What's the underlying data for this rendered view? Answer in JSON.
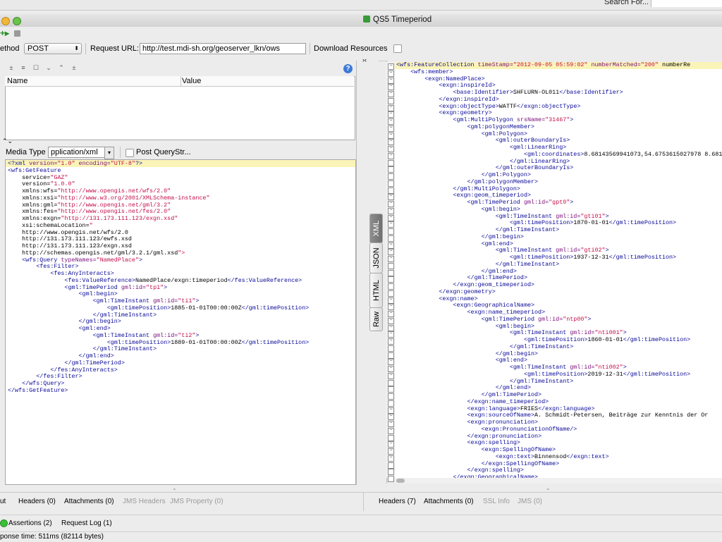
{
  "search": {
    "label": "Search For..."
  },
  "window": {
    "title": "QS5 Timeperiod"
  },
  "toolbar": {
    "method_label": "ethod",
    "method_value": "POST",
    "request_url_label": "Request URL:",
    "request_url_value": "http://test.mdi-sh.org/geoserver_lkn/ows",
    "download_label": "Download Resources"
  },
  "params": {
    "col_name": "Name",
    "col_value": "Value"
  },
  "media": {
    "label": "Media Type",
    "value": "pplication/xml",
    "post_query_label": "Post QueryStr..."
  },
  "side_tabs": [
    "XML",
    "JSON",
    "HTML",
    "Raw"
  ],
  "request_xml": [
    "<?xml version=\"1.0\" encoding=\"UTF-8\"?>",
    "<wfs:GetFeature",
    "    service=\"GAZ\"",
    "    version=\"1.0.0\"",
    "    xmlns:wfs=\"http://www.opengis.net/wfs/2.0\"",
    "    xmlns:xsi=\"http://www.w3.org/2001/XMLSchema-instance\"",
    "    xmlns:gml=\"http://www.opengis.net/gml/3.2\"",
    "    xmlns:fes=\"http://www.opengis.net/fes/2.0\"",
    "    xmlns:exgn=\"http://131.173.111.123/exgn.xsd\"",
    "    xsi:schemaLocation=\"",
    "    http://www.opengis.net/wfs/2.0",
    "    http://131.173.111.123/ewfs.xsd",
    "    http://131.173.111.123/exgn.xsd",
    "    http://schemas.opengis.net/gml/3.2.1/gml.xsd\">",
    "    <wfs:Query typeNames=\"NamedPlace\">",
    "        <fes:Filter>",
    "            <fes:AnyInteracts>",
    "                <fes:ValueReference>NamedPlace/exgn:timeperiod</fes:ValueReference>",
    "                <gml:TimePeriod gml:id=\"tp1\">",
    "                    <gml:begin>",
    "                        <gml:TimeInstant gml:id=\"ti1\">",
    "                            <gml:timePosition>1885-01-01T00:00:00Z</gml:timePosition>",
    "                        </gml:TimeInstant>",
    "                    </gml:begin>",
    "                    <gml:end>",
    "                        <gml:TimeInstant gml:id=\"ti2\">",
    "                            <gml:timePosition>1889-01-01T00:00:00Z</gml:timePosition>",
    "                        </gml:TimeInstant>",
    "                    </gml:end>",
    "                </gml:TimePeriod>",
    "            </fes:AnyInteracts>",
    "        </fes:Filter>",
    "    </wfs:Query>",
    "</wfs:GetFeature>"
  ],
  "response_xml": [
    "<wfs:FeatureCollection timeStamp=\"2012-09-05 05:59:02\" numberMatched=\"200\" numberRe",
    "    <wfs:member>",
    "        <exgn:NamedPlace>",
    "            <exgn:inspireId>",
    "                <base:Identifier>SHFLURN-OL011</base:Identifier>",
    "            </exgn:inspireId>",
    "            <exgn:objectType>WATTF</exgn:objectType>",
    "            <exgn:geometry>",
    "                <gml:MultiPolygon srsName=\"31467\">",
    "                    <gml:polygonMember>",
    "                        <gml:Polygon>",
    "                            <gml:outerBoundaryIs>",
    "                                <gml:LinearRing>",
    "                                    <gml:coordinates>8.68143569941073,54.6753615027978 8.681",
    "                                </gml:LinearRing>",
    "                            </gml:outerBoundaryIs>",
    "                        </gml:Polygon>",
    "                    </gml:polygonMember>",
    "                </gml:MultiPolygon>",
    "                <exgn:geom_timeperiod>",
    "                    <gml:TimePeriod gml:id=\"gpt0\">",
    "                        <gml:begin>",
    "                            <gml:TimeInstant gml:id=\"gti01\">",
    "                                <gml:timePosition>1870-01-01</gml:timePosition>",
    "                            </gml:TimeInstant>",
    "                        </gml:begin>",
    "                        <gml:end>",
    "                            <gml:TimeInstant gml:id=\"gti02\">",
    "                                <gml:timePosition>1937-12-31</gml:timePosition>",
    "                            </gml:TimeInstant>",
    "                        </gml:end>",
    "                    </gml:TimePeriod>",
    "                </exgn:geom_timeperiod>",
    "            </exgn:geometry>",
    "            <exgn:name>",
    "                <exgn:GeographicalName>",
    "                    <exgn:name_timeperiod>",
    "                        <gml:TimePeriod gml:id=\"ntp00\">",
    "                            <gml:begin>",
    "                                <gml:TimeInstant gml:id=\"nti001\">",
    "                                    <gml:timePosition>1860-01-01</gml:timePosition>",
    "                                </gml:TimeInstant>",
    "                            </gml:begin>",
    "                            <gml:end>",
    "                                <gml:TimeInstant gml:id=\"nti002\">",
    "                                    <gml:timePosition>2019-12-31</gml:timePosition>",
    "                                </gml:TimeInstant>",
    "                            </gml:end>",
    "                        </gml:TimePeriod>",
    "                    </exgn:name_timeperiod>",
    "                    <exgn:language>FRIES</exgn:language>",
    "                    <exgn:sourceOfName>A. Schmidt-Petersen, Beiträge zur Kenntnis der Or",
    "                    <exgn:pronunciation>",
    "                        <exgn:PronunciationOfName/>",
    "                    </exgn:pronunciation>",
    "                    <exgn:spelling>",
    "                        <exgn:SpellingOfName>",
    "                            <exgn:text>Binnensod</exgn:text>",
    "                        </exgn:SpellingOfName>",
    "                    </exgn:spelling>",
    "                </exgn:GeographicalName>"
  ],
  "left_tabs": [
    {
      "label": "ut",
      "disabled": false
    },
    {
      "label": "Headers (0)",
      "disabled": false
    },
    {
      "label": "Attachments (0)",
      "disabled": false
    },
    {
      "label": "JMS Headers",
      "disabled": true
    },
    {
      "label": "JMS Property (0)",
      "disabled": true
    }
  ],
  "right_tabs": [
    {
      "label": "Headers (7)",
      "disabled": false
    },
    {
      "label": "Attachments (0)",
      "disabled": false
    },
    {
      "label": "SSL Info",
      "disabled": true
    },
    {
      "label": "JMS (0)",
      "disabled": true
    }
  ],
  "log_tabs": {
    "assertions": "Assertions (2)",
    "request_log": "Request Log (1)"
  },
  "status": {
    "text": "ponse time: 511ms (82114 bytes)"
  },
  "colors": {
    "assert_ok": "#39c135",
    "highlight": "#fbf4b8",
    "tag": "#0a0a99",
    "attr": "#7a0f7a",
    "value": "#c2104a"
  }
}
